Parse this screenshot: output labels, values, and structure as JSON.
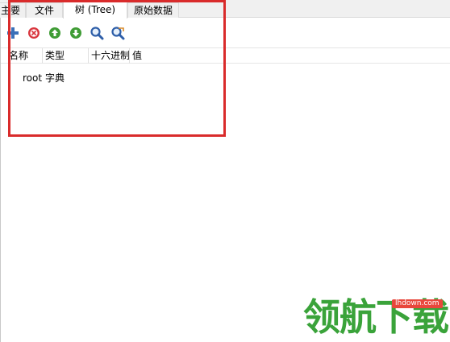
{
  "tabs": [
    {
      "label": "主要",
      "active": false
    },
    {
      "label": "文件",
      "active": false
    },
    {
      "label": "树 (Tree)",
      "active": true
    },
    {
      "label": "原始数据",
      "active": false
    }
  ],
  "toolbar": {
    "buttons": [
      {
        "icon": "add-icon",
        "color": "#3a6fb8"
      },
      {
        "icon": "remove-icon",
        "color": "#d9363e"
      },
      {
        "icon": "move-up-icon",
        "color": "#3f9c35"
      },
      {
        "icon": "move-down-icon",
        "color": "#3f9c35"
      },
      {
        "icon": "search-icon",
        "color": "#2e5ea8"
      },
      {
        "icon": "search-replace-icon",
        "color": "#2e5ea8"
      }
    ]
  },
  "list": {
    "columns": [
      "名称",
      "类型",
      "十六进制",
      "值"
    ],
    "rows": [
      {
        "name": "root",
        "type": "字典",
        "hex": "",
        "value": ""
      }
    ]
  },
  "colors": {
    "highlight": "#d92b2b",
    "watermark_green": "#3aa33a",
    "watermark_badge": "#e8473c"
  },
  "watermark": {
    "brand": "领航下载",
    "url": "lhdown.com"
  }
}
